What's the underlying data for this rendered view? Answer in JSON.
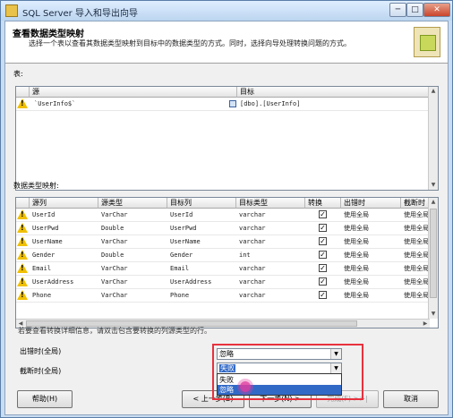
{
  "window": {
    "title": "SQL Server 导入和导出向导",
    "minimize": "─",
    "maximize": "□",
    "close": "✕"
  },
  "header": {
    "title": "查看数据类型映射",
    "description": "选择一个表以查看其数据类型映射到目标中的数据类型的方式。同时，选择向导处理转换问题的方式。"
  },
  "tables_label": "表:",
  "tables_grid": {
    "columns": [
      "源",
      "目标"
    ],
    "rows": [
      {
        "source": "`UserInfo$`",
        "target": "[dbo].[UserInfo]"
      }
    ]
  },
  "mapping_label": "数据类型映射:",
  "mapping_grid": {
    "columns": [
      "源列",
      "源类型",
      "目标列",
      "目标类型",
      "转换",
      "出错时",
      "截断时"
    ],
    "rows": [
      {
        "src_col": "UserId",
        "src_type": "VarChar",
        "dst_col": "UserId",
        "dst_type": "varchar",
        "convert": true,
        "on_error": "使用全局",
        "on_trunc": "使用全局"
      },
      {
        "src_col": "UserPwd",
        "src_type": "Double",
        "dst_col": "UserPwd",
        "dst_type": "varchar",
        "convert": true,
        "on_error": "使用全局",
        "on_trunc": "使用全局"
      },
      {
        "src_col": "UserName",
        "src_type": "VarChar",
        "dst_col": "UserName",
        "dst_type": "varchar",
        "convert": true,
        "on_error": "使用全局",
        "on_trunc": "使用全局"
      },
      {
        "src_col": "Gender",
        "src_type": "Double",
        "dst_col": "Gender",
        "dst_type": "int",
        "convert": true,
        "on_error": "使用全局",
        "on_trunc": "使用全局"
      },
      {
        "src_col": "Email",
        "src_type": "VarChar",
        "dst_col": "Email",
        "dst_type": "varchar",
        "convert": true,
        "on_error": "使用全局",
        "on_trunc": "使用全局"
      },
      {
        "src_col": "UserAddress",
        "src_type": "VarChar",
        "dst_col": "UserAddress",
        "dst_type": "varchar",
        "convert": true,
        "on_error": "使用全局",
        "on_trunc": "使用全局"
      },
      {
        "src_col": "Phone",
        "src_type": "VarChar",
        "dst_col": "Phone",
        "dst_type": "varchar",
        "convert": true,
        "on_error": "使用全局",
        "on_trunc": "使用全局"
      }
    ]
  },
  "hint": "若要查看转换详细信息，请双击包含要转换的列源类型的行。",
  "global": {
    "on_error_label": "出错时(全局)",
    "on_error_value": "忽略",
    "on_trunc_label": "截断时(全局)",
    "on_trunc_value": "失败",
    "dropdown_options": [
      "失败",
      "忽略"
    ],
    "dropdown_highlighted": "忽略"
  },
  "buttons": {
    "help": "帮助(H)",
    "back": "< 上一步(B)",
    "next": "下一步(N) >",
    "finish": "完成(F) >>|",
    "cancel": "取消"
  },
  "icons": {
    "warning": "warning-icon",
    "table": "table-icon"
  },
  "colors": {
    "highlight": "#3169c6",
    "annotation_box": "#e8313d",
    "warning": "#f0c000"
  }
}
